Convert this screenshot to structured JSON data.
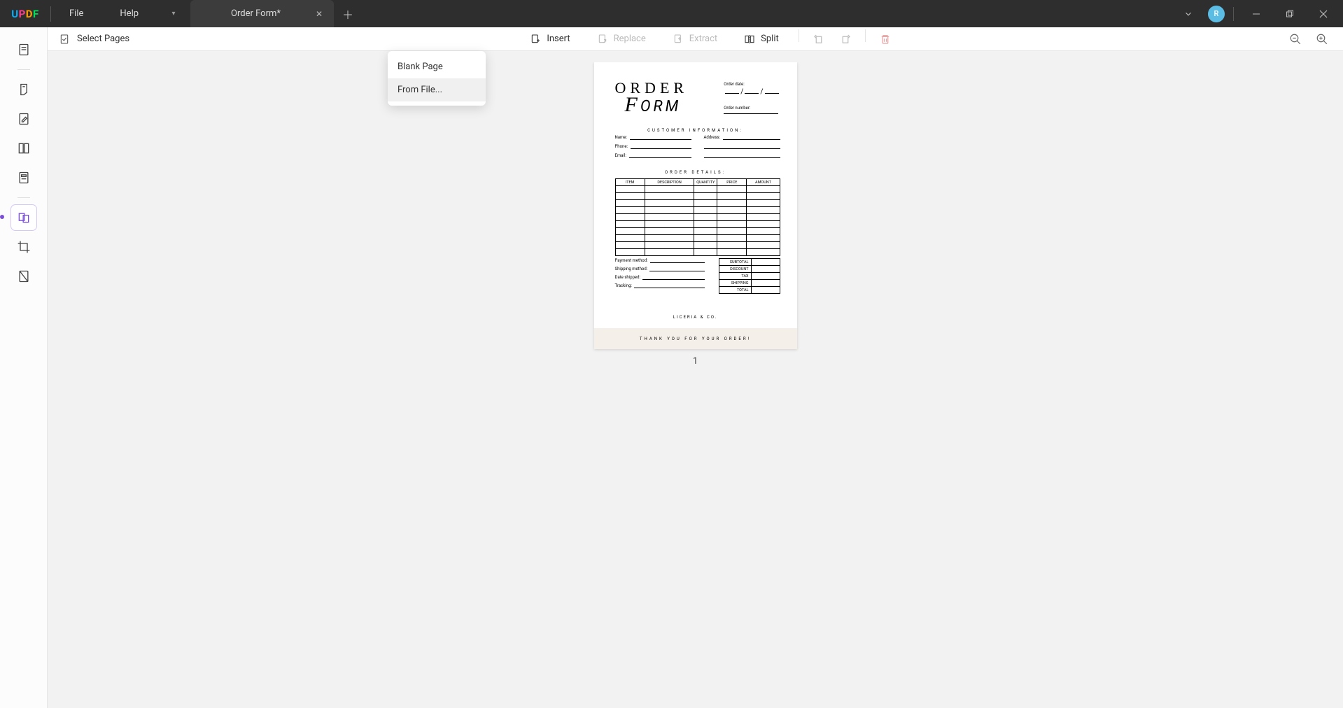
{
  "app": {
    "logo_letters": [
      "U",
      "P",
      "D",
      "F"
    ]
  },
  "menu": {
    "file": "File",
    "help": "Help"
  },
  "tab": {
    "title": "Order Form*"
  },
  "avatar_initial": "R",
  "toolbar": {
    "select_pages": "Select Pages",
    "insert": "Insert",
    "replace": "Replace",
    "extract": "Extract",
    "split": "Split"
  },
  "dropdown": {
    "blank_page": "Blank Page",
    "from_file": "From File..."
  },
  "page_number": "1",
  "order_form": {
    "title_line1": "ORDER",
    "title_line2_script": "F",
    "title_line2_rest": "ORM",
    "order_date_label": "Order date:",
    "order_number_label": "Order number:",
    "customer_info_heading": "CUSTOMER INFORMATION:",
    "name_label": "Name:",
    "phone_label": "Phone:",
    "email_label": "Email:",
    "address_label": "Address:",
    "order_details_heading": "ORDER DETAILS:",
    "columns": [
      "ITEM",
      "DESCRIPTION",
      "QUANTITY",
      "PRICE",
      "AMOUNT"
    ],
    "payment_method_label": "Payment method:",
    "shipping_method_label": "Shipping method:",
    "date_shipped_label": "Date shipped:",
    "tracking_label": "Tracking:",
    "totals": [
      "SUBTOTAL",
      "DISCOUNT",
      "TAX",
      "SHIPPING",
      "TOTAL"
    ],
    "brand": "LICERIA & CO.",
    "thanks": "THANK YOU FOR YOUR ORDER!"
  }
}
